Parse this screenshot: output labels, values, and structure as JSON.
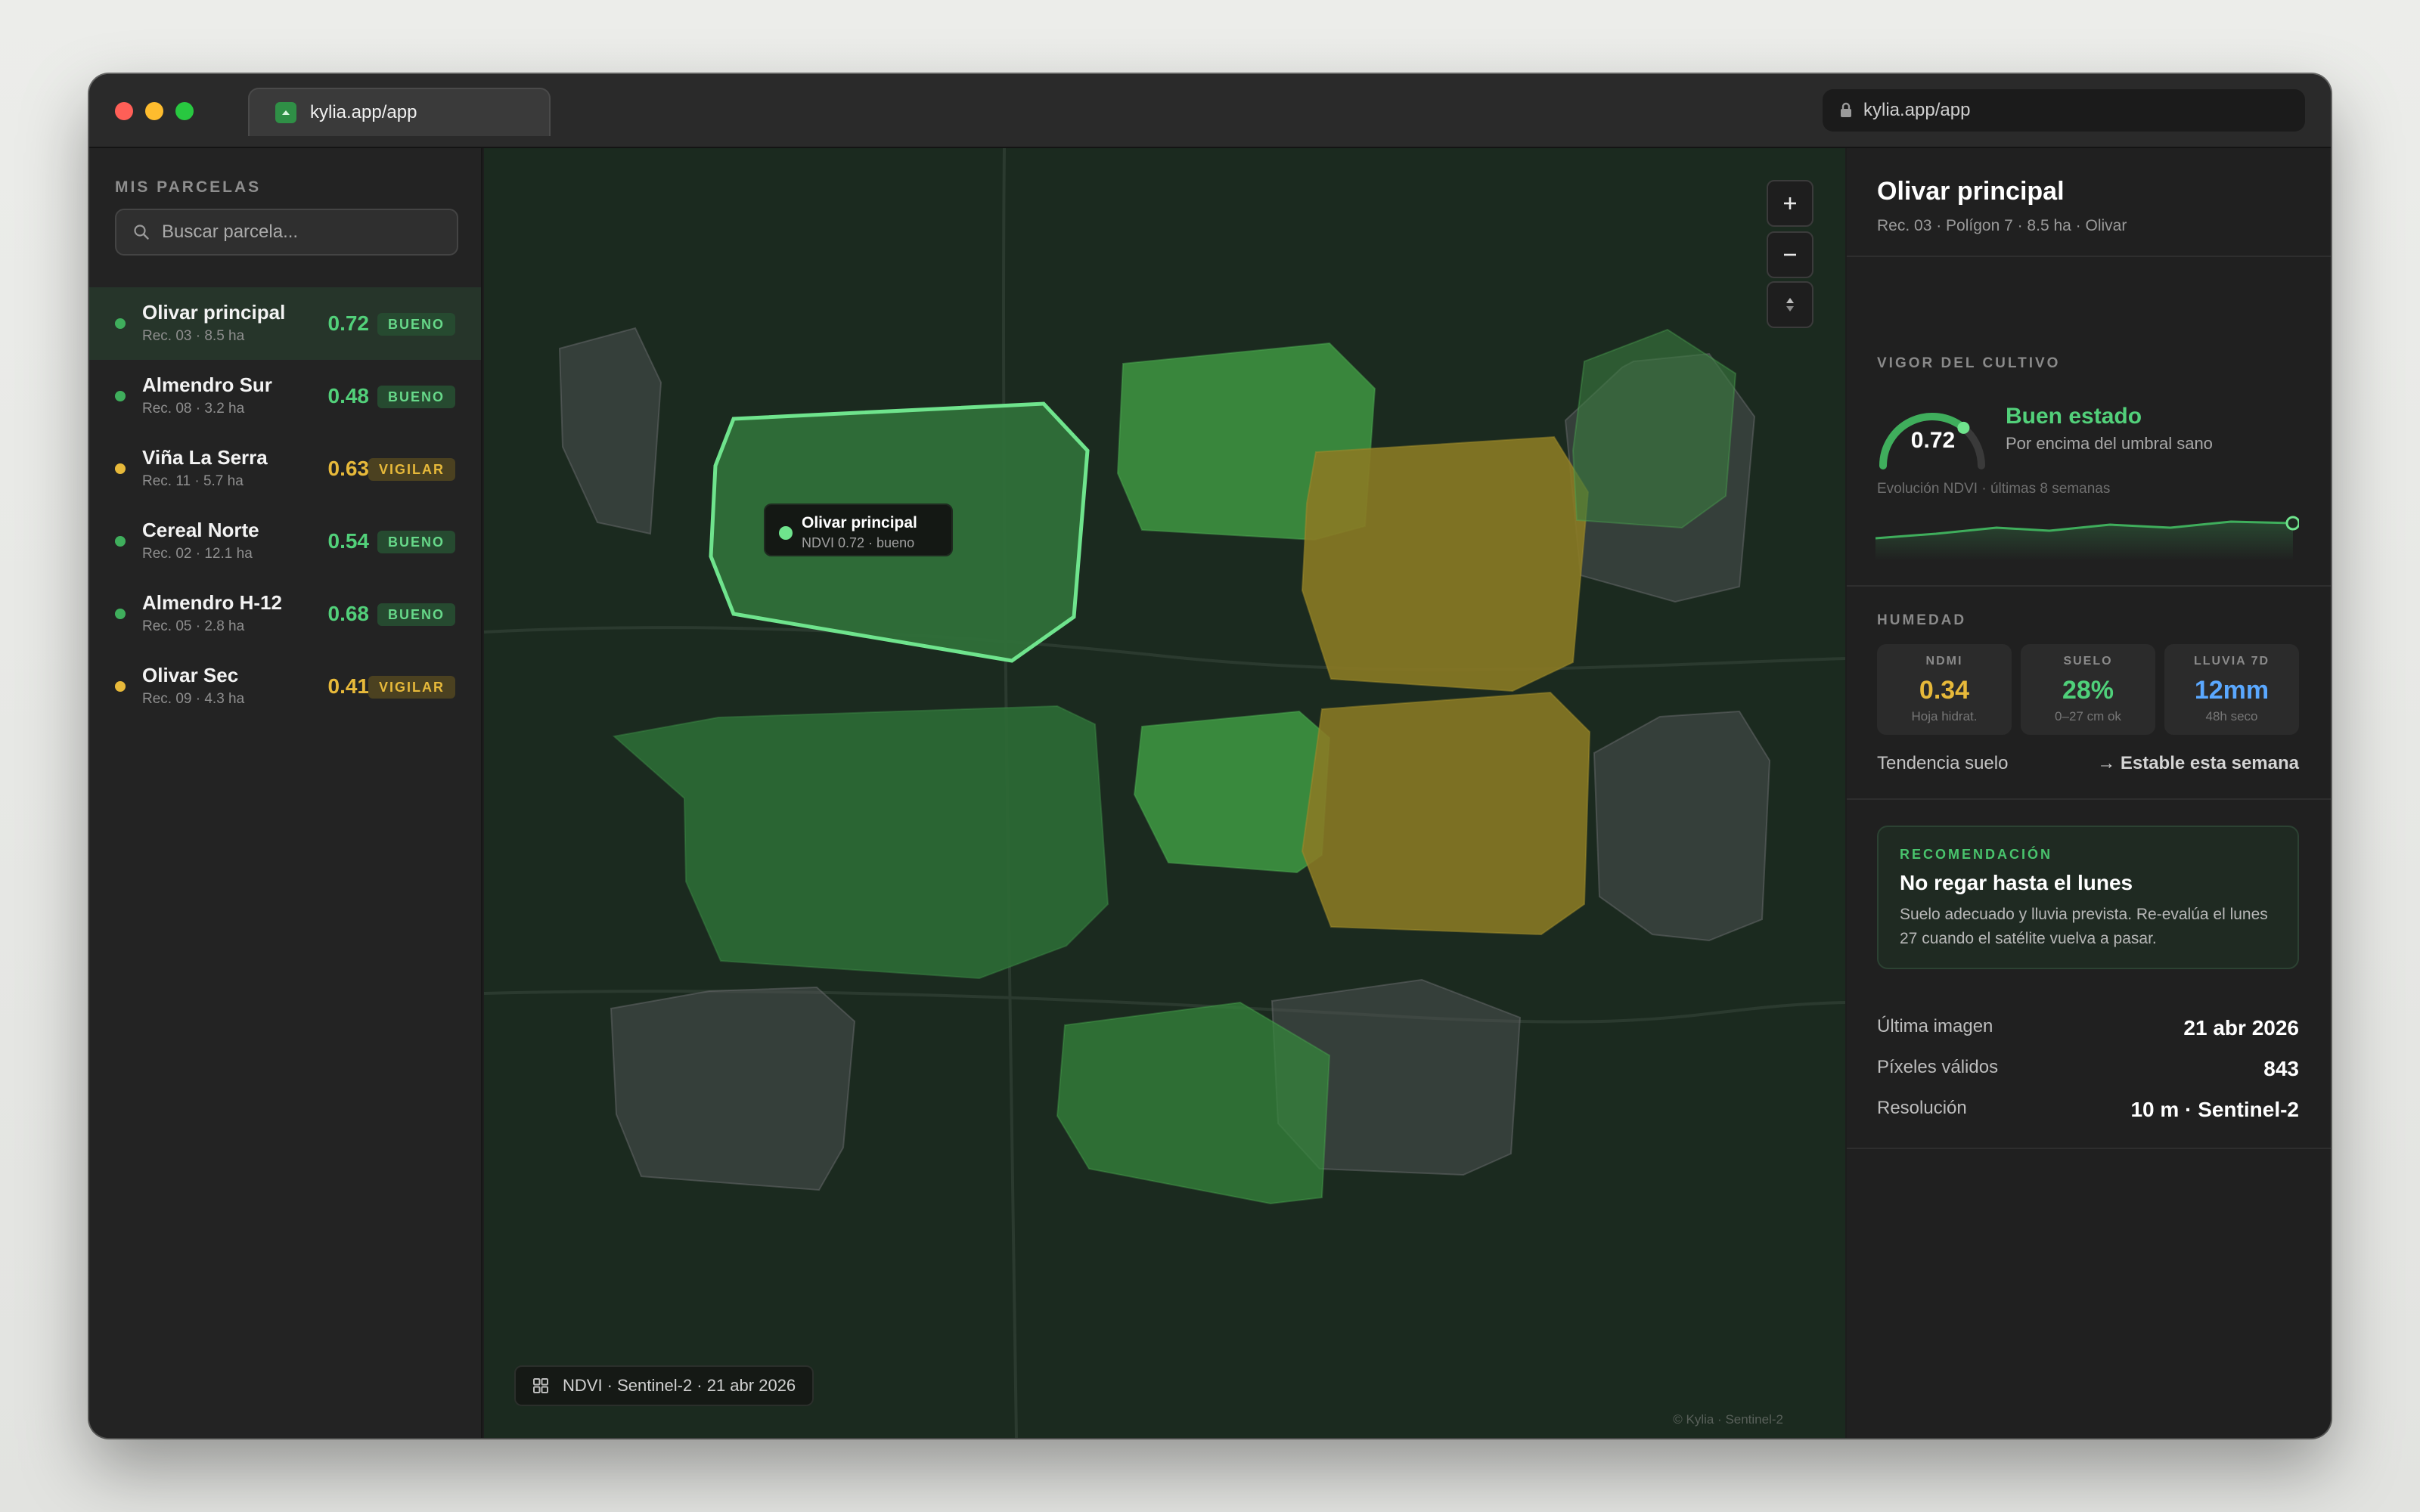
{
  "browser": {
    "tab_title": "kylia.app/app",
    "url": "kylia.app/app"
  },
  "sidebar": {
    "title": "MIS PARCELAS",
    "search_placeholder": "Buscar parcela...",
    "items": [
      {
        "name": "Olivar principal",
        "sub": "Rec. 03 · 8.5 ha",
        "value": "0.72",
        "badge": "BUENO",
        "status": "good"
      },
      {
        "name": "Almendro Sur",
        "sub": "Rec. 08 · 3.2 ha",
        "value": "0.48",
        "badge": "BUENO",
        "status": "good"
      },
      {
        "name": "Viña La Serra",
        "sub": "Rec. 11 · 5.7 ha",
        "value": "0.63",
        "badge": "VIGILAR",
        "status": "warn"
      },
      {
        "name": "Cereal Norte",
        "sub": "Rec. 02 · 12.1 ha",
        "value": "0.54",
        "badge": "BUENO",
        "status": "good"
      },
      {
        "name": "Almendro H-12",
        "sub": "Rec. 05 · 2.8 ha",
        "value": "0.68",
        "badge": "BUENO",
        "status": "good"
      },
      {
        "name": "Olivar Sec",
        "sub": "Rec. 09 · 4.3 ha",
        "value": "0.41",
        "badge": "VIGILAR",
        "status": "warn"
      }
    ]
  },
  "map": {
    "tooltip_name": "Olivar principal",
    "tooltip_sub": "NDVI 0.72 · bueno",
    "layer_label": "NDVI · Sentinel-2 · 21 abr 2026",
    "attribution": "© Kylia · Sentinel-2",
    "controls": {
      "zoom_in_icon": "plus-icon",
      "zoom_out_icon": "minus-icon",
      "compass_icon": "compass-icon"
    }
  },
  "panel": {
    "title": "Olivar principal",
    "subtitle": "Rec. 03 · Polígon 7 · 8.5 ha · Olivar",
    "vigor": {
      "section_title": "VIGOR DEL CULTIVO",
      "value": "0.72",
      "gauge_fraction": 0.72,
      "state": "Buen estado",
      "description": "Por encima del umbral sano",
      "evolution_label": "Evolución NDVI · últimas 8 semanas"
    },
    "humidity": {
      "section_title": "HUMEDAD",
      "cards": [
        {
          "label": "NDMI",
          "value": "0.34",
          "sub": "Hoja hidrat.",
          "color": "#e7b93a"
        },
        {
          "label": "SUELO",
          "value": "28%",
          "sub": "0–27 cm ok",
          "color": "#4fd07a"
        },
        {
          "label": "LLUVIA 7D",
          "value": "12mm",
          "sub": "48h seco",
          "color": "#5aa8ff"
        }
      ],
      "trend_label": "Tendencia suelo",
      "trend_value": "→ Estable esta semana"
    },
    "recommendation": {
      "tag": "RECOMENDACIÓN",
      "title": "No regar hasta el lunes",
      "body": "Suelo adecuado y lluvia prevista. Re-evalúa el lunes 27 cuando el satélite vuelva a pasar."
    },
    "meta": [
      {
        "label": "Última imagen",
        "value": "21 abr 2026"
      },
      {
        "label": "Píxeles válidos",
        "value": "843"
      },
      {
        "label": "Resolución",
        "value": "10 m · Sentinel-2"
      }
    ]
  },
  "colors": {
    "good": "#3fae5c",
    "warn": "#e7b93a",
    "accent": "#52d07a"
  }
}
